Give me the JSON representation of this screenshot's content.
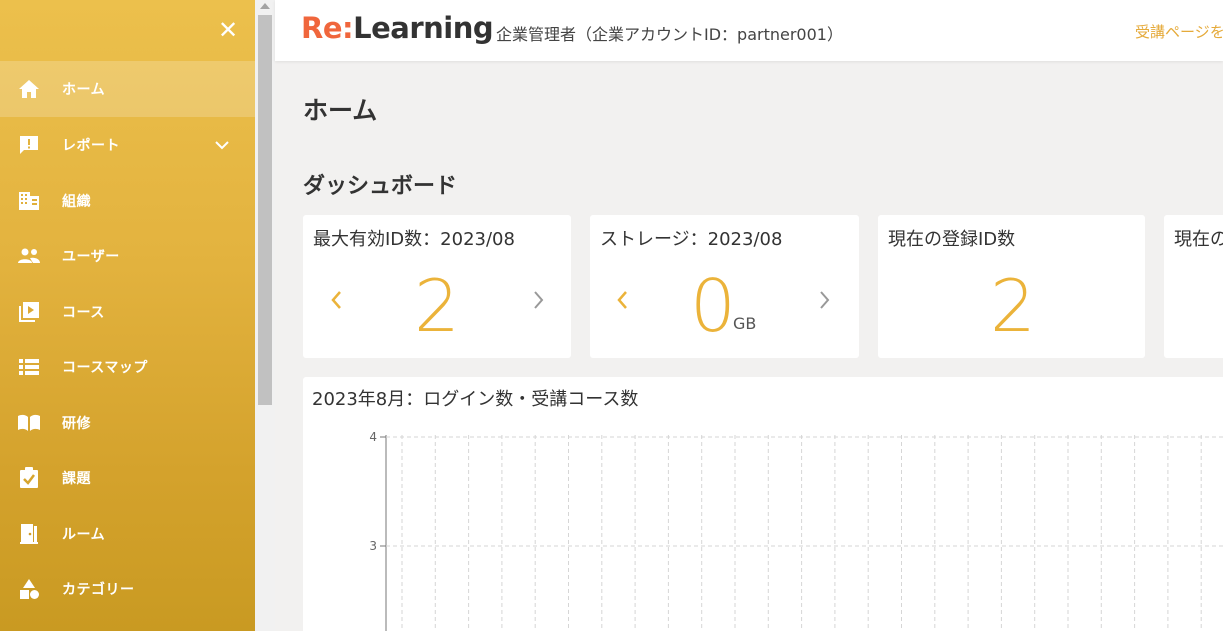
{
  "sidebar": {
    "items": [
      {
        "label": "ホーム",
        "icon": "home-icon"
      },
      {
        "label": "レポート",
        "icon": "report-icon"
      },
      {
        "label": "組織",
        "icon": "organization-icon"
      },
      {
        "label": "ユーザー",
        "icon": "users-icon"
      },
      {
        "label": "コース",
        "icon": "course-icon"
      },
      {
        "label": "コースマップ",
        "icon": "course-map-icon"
      },
      {
        "label": "研修",
        "icon": "training-icon"
      },
      {
        "label": "課題",
        "icon": "assignment-icon"
      },
      {
        "label": "ルーム",
        "icon": "room-icon"
      },
      {
        "label": "カテゴリー",
        "icon": "category-icon"
      }
    ],
    "close_symbol": "✕"
  },
  "header": {
    "logo_prefix": "Re:",
    "logo_suffix": "Learning",
    "subtitle": "企業管理者（企業アカウントID：partner001）",
    "link": "受講ページを"
  },
  "main": {
    "page_title": "ホーム",
    "section_title": "ダッシュボード",
    "cards": [
      {
        "title": "最大有効ID数：2023/08",
        "value": "2"
      },
      {
        "title": "ストレージ：2023/08",
        "value": "0",
        "unit": "GB"
      },
      {
        "title": "現在の登録ID数",
        "value": "2"
      },
      {
        "title": "現在の"
      }
    ],
    "chart_title": "2023年8月：ログイン数・受講コース数"
  },
  "colors": {
    "accent": "#ebb33a",
    "brand_red": "#f0663c",
    "sidebar_top": "#ecc04c",
    "sidebar_bottom": "#c99a22"
  },
  "chart_data": {
    "type": "line",
    "title": "2023年8月：ログイン数・受講コース数",
    "y_ticks": [
      "4",
      "3"
    ],
    "ylim": [
      2,
      4
    ],
    "grid": true,
    "series": []
  }
}
